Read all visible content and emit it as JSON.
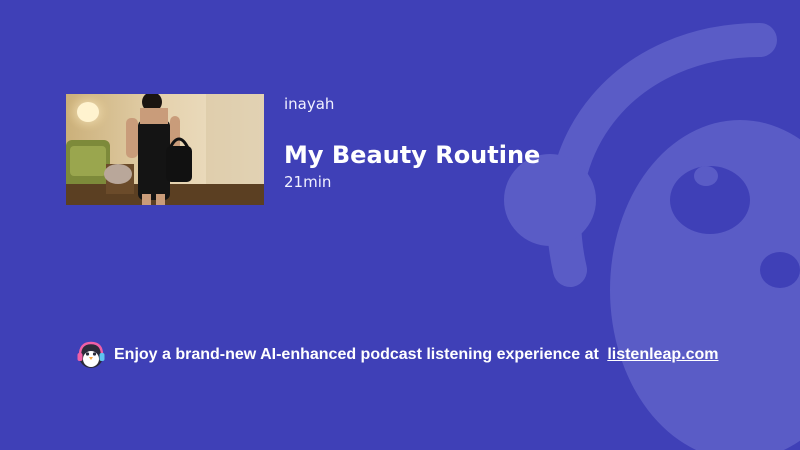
{
  "colors": {
    "background": "#3f40b7",
    "mascot_overlay": "#5a5cc6",
    "text": "#ffffff"
  },
  "episode": {
    "author": "inayah",
    "title": "My Beauty Routine",
    "duration": "21min",
    "cover_icon": "episode-cover-image"
  },
  "promo": {
    "icon": "penguin-headphones-icon",
    "text": "Enjoy a brand-new AI-enhanced podcast listening experience at",
    "link_label": "listenleap.com"
  }
}
